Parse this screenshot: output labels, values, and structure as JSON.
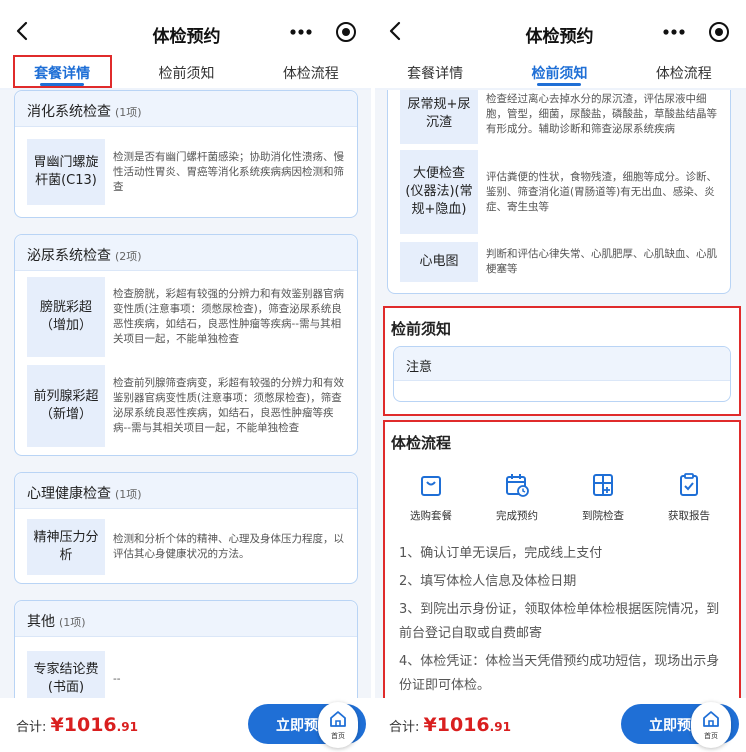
{
  "left": {
    "header": {
      "title": "体检预约"
    },
    "tabs": [
      "套餐详情",
      "检前须知",
      "体检流程"
    ],
    "sections": [
      {
        "title": "消化系统检查",
        "count": "(1项)",
        "items": [
          {
            "name": "胃幽门螺旋杆菌(C13)",
            "desc": "检测是否有幽门螺杆菌感染；协助消化性溃疡、慢性活动性胃炎、胃癌等消化系统疾病病因检测和筛查"
          }
        ]
      },
      {
        "title": "泌尿系统检查",
        "count": "(2项)",
        "items": [
          {
            "name": "膀胱彩超（增加）",
            "desc": "检查膀胱，彩超有较强的分辨力和有效鉴别器官病变性质(注意事项：须憋尿检查)，筛查泌尿系统良恶性疾病，如结石，良恶性肿瘤等疾病--需与其相关项目一起，不能单独检查"
          },
          {
            "name": "前列腺彩超（新增）",
            "desc": "检查前列腺筛查病变，彩超有较强的分辨力和有效鉴别器官病变性质(注意事项：须憋尿检查)，筛查泌尿系统良恶性疾病，如结石，良恶性肿瘤等疾病--需与其相关项目一起，不能单独检查"
          }
        ]
      },
      {
        "title": "心理健康检查",
        "count": "(1项)",
        "items": [
          {
            "name": "精神压力分析",
            "desc": "检测和分析个体的精神、心理及身体压力程度，以评估其心身健康状况的方法。"
          }
        ]
      },
      {
        "title": "其他",
        "count": "(1项)",
        "items": [
          {
            "name": "专家结论费(书面)",
            "desc": "--"
          }
        ]
      }
    ],
    "bottom": {
      "total_label": "合计:",
      "currency": "¥",
      "price": "1016",
      "decimal": ".91",
      "book_label": "立即预约",
      "home_label": "首页"
    }
  },
  "right": {
    "header": {
      "title": "体检预约"
    },
    "tabs": [
      "套餐详情",
      "检前须知",
      "体检流程"
    ],
    "items": [
      {
        "name": "尿常规+尿沉渣",
        "desc": "检查经过离心去掉水分的尿沉渣，评估尿液中细胞，管型，细菌，尿酸盐，磷酸盐，草酸盐结晶等有形成分。辅助诊断和筛查泌尿系统疾病"
      },
      {
        "name": "大便检查(仪器法)(常规+隐血)",
        "desc": "评估粪便的性状，食物残渣，细胞等成分。诊断、鉴别、筛查消化道(胃肠道等)有无出血、感染、炎症、寄生虫等"
      },
      {
        "name": "心电图",
        "desc": "判断和评估心律失常、心肌肥厚、心肌缺血、心肌梗塞等"
      }
    ],
    "pre_notice": {
      "title": "检前须知",
      "note": "注意"
    },
    "process": {
      "title": "体检流程",
      "steps": [
        "选购套餐",
        "完成预约",
        "到院检查",
        "获取报告"
      ],
      "lines": [
        "1、确认订单无误后，完成线上支付",
        "2、填写体检人信息及体检日期",
        "3、到院出示身份证，领取体检单体检根据医院情况，到前台登记自取或自费邮寄",
        "4、体检凭证：体检当天凭借预约成功短信，现场出示身份证即可体检。"
      ]
    },
    "bottom": {
      "total_label": "合计:",
      "currency": "¥",
      "price": "1016",
      "decimal": ".91",
      "book_label": "立即预约",
      "home_label": "首页"
    }
  },
  "colors": {
    "accent": "#1f6fd6",
    "highlight_box": "#e02b2b",
    "price": "#d91f1f"
  },
  "icons": [
    "back-icon",
    "more-icon",
    "target-icon",
    "bag-icon",
    "calendar-icon",
    "hospital-icon",
    "report-icon",
    "home-icon"
  ]
}
